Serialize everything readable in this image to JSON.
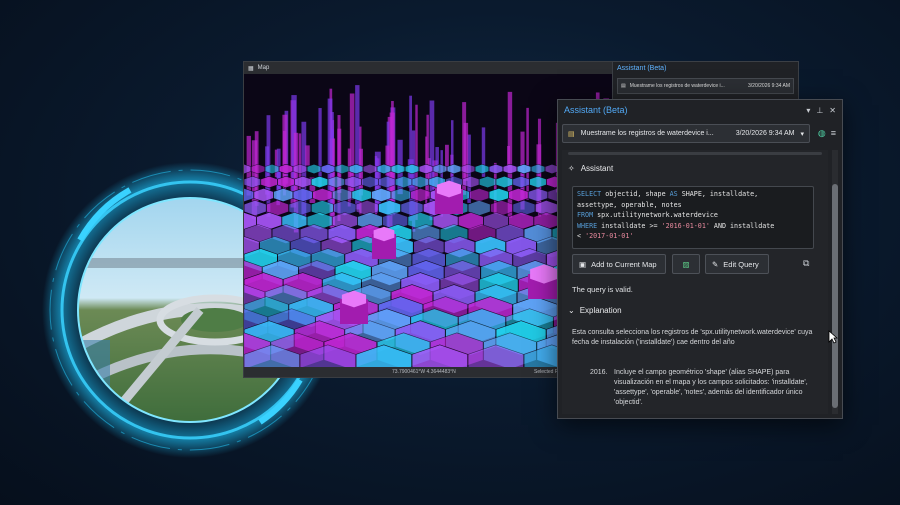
{
  "map_window": {
    "title": "Map",
    "coordinates": "73.7900461°W 4.3644483°N",
    "selected_label": "Selected Fe"
  },
  "assistant_back": {
    "title": "Assistant (Beta)",
    "conversation": "Muestrame los registros de waterdevice i...",
    "date": "3/20/2026 9:34 AM"
  },
  "assistant": {
    "title": "Assistant (Beta)",
    "conversation_title": "Muestrame los registros de waterdevice i...",
    "conversation_date": "3/20/2026 9:34 AM",
    "section_label": "Assistant",
    "sql": {
      "line1_a": "SELECT",
      "line1_b": " objectid, shape ",
      "line1_c": "AS",
      "line1_d": " SHAPE, installdate,",
      "line2": "assettype, operable, notes",
      "line3_a": "FROM",
      "line3_b": " spx.utilitynetwork.waterdevice",
      "line4_a": "WHERE",
      "line4_b": " installdate >= ",
      "line4_c": "'2016-01-01'",
      "line4_d": " AND installdate",
      "line5_a": "< ",
      "line5_b": "'2017-01-01'"
    },
    "buttons": {
      "add_to_map": "Add to Current Map",
      "edit_query": "Edit Query"
    },
    "valid_text": "The query is valid.",
    "explanation_label": "Explanation",
    "explanation_text": "Esta consulta selecciona los registros de 'spx.utilitynetwork.waterdevice' cuya fecha de instalación ('installdate') cae dentro del año",
    "list_number": "2016.",
    "list_text": "Incluye el campo geométrico 'shape' (alias SHAPE) para visualización en el mapa y los campos solicitados: 'installdate', 'assettype', 'operable', 'notes', además del identificador único 'objectid'."
  },
  "colors": {
    "accent_blue": "#52a9f5",
    "sql_keyword": "#569cd6",
    "sql_string": "#e88a9e",
    "panel_bg": "#202226",
    "hex_magenta": "#c026d3",
    "hex_cyan": "#22d3ee"
  },
  "icons": [
    "pin-icon",
    "chevron-icon",
    "close-icon",
    "conversation-icon",
    "chat-icon",
    "menu-icon",
    "sparkle-icon",
    "add-map-icon",
    "edit-icon",
    "copy-icon",
    "collapse-icon",
    "map-preview-icon"
  ]
}
